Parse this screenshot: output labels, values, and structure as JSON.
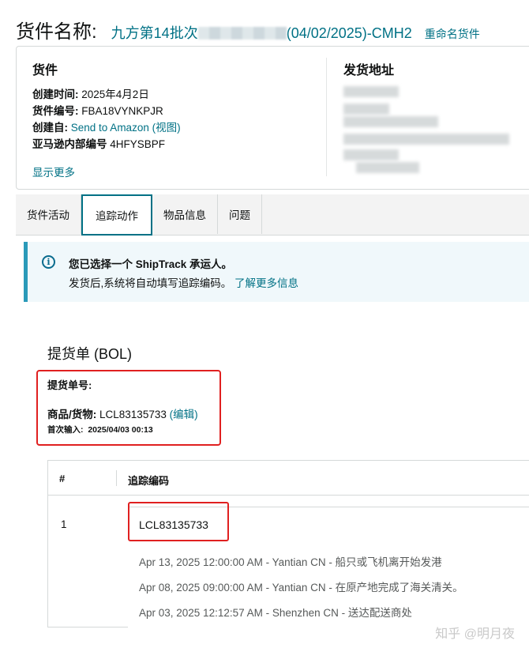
{
  "header": {
    "title_label": "货件名称:",
    "shipment_name_prefix": "九方第14批次",
    "shipment_name_suffix": "(04/02/2025)-CMH2",
    "rename_link": "重命名货件"
  },
  "shipment": {
    "section_title": "货件",
    "created_label": "创建时间:",
    "created_value": "2025年4月2日",
    "id_label": "货件编号:",
    "id_value": "FBA18VYNKPJR",
    "created_by_label": "创建自:",
    "created_by_value": "Send to Amazon (视图)",
    "internal_label": "亚马逊内部编号",
    "internal_value": "4HFYSBPF",
    "show_more": "显示更多"
  },
  "address": {
    "section_title": "发货地址"
  },
  "tabs": [
    {
      "label": "货件活动",
      "active": false
    },
    {
      "label": "追踪动作",
      "active": true
    },
    {
      "label": "物品信息",
      "active": false
    },
    {
      "label": "问题",
      "active": false
    }
  ],
  "alert": {
    "icon": "info-icon",
    "title": "您已选择一个 ShipTrack 承运人。",
    "text": "发货后,系统将自动填写追踪编码。",
    "link": "了解更多信息"
  },
  "bol": {
    "title": "提货单 (BOL)",
    "number_label": "提货单号:",
    "goods_label": "商品/货物:",
    "goods_value": "LCL83135733",
    "edit_link": "(编辑)",
    "first_entry_label": "首次输入:",
    "first_entry_value": "2025/04/03 00:13"
  },
  "tracking_table": {
    "headers": [
      "#",
      "追踪编码"
    ],
    "rows": [
      {
        "index": "1",
        "code": "LCL83135733",
        "events": [
          "Apr 13, 2025 12:00:00 AM - Yantian CN - 船只或飞机离开始发港",
          "Apr 08, 2025 09:00:00 AM - Yantian CN - 在原产地完成了海关清关。",
          "Apr 03, 2025 12:12:57 AM - Shenzhen CN - 送达配送商处"
        ]
      }
    ]
  },
  "watermark": "知乎 @明月夜",
  "colors": {
    "link": "#007185",
    "highlight_box": "#e02020",
    "alert_bg": "#f0f8fb",
    "alert_accent": "#2a9ab9"
  }
}
